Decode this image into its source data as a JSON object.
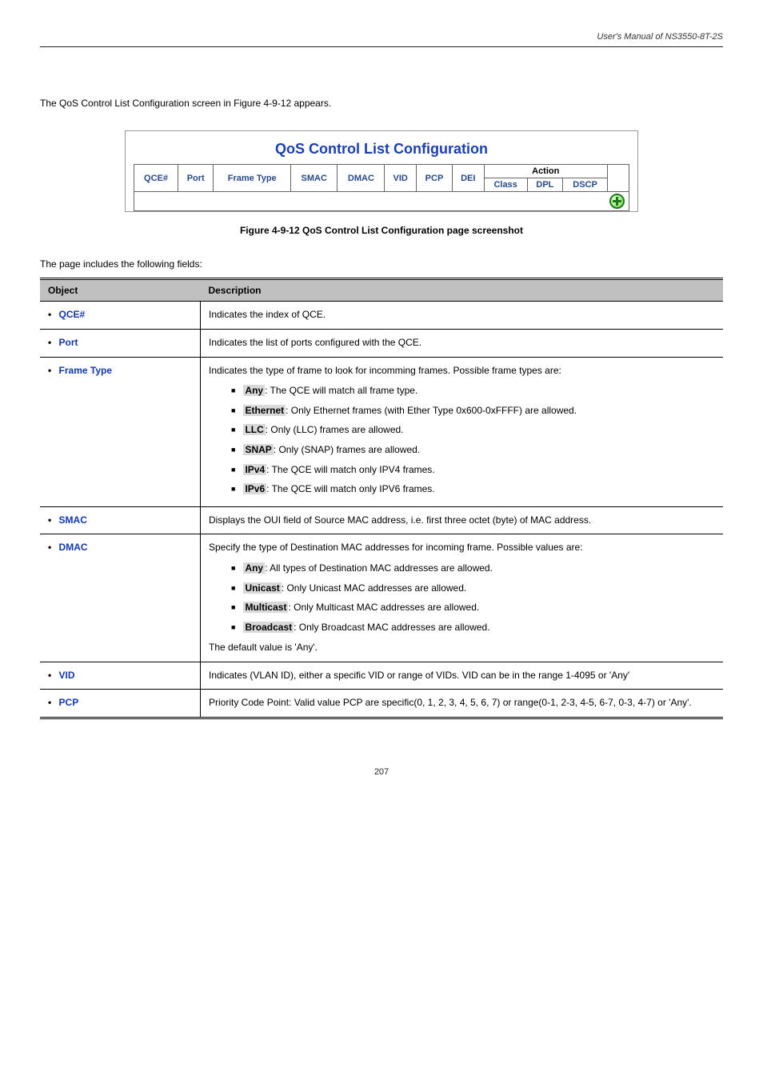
{
  "header": {
    "text": "User's Manual of NS3550-8T-2S"
  },
  "intro": "The QoS Control List Configuration screen in Figure 4-9-12 appears.",
  "screenshot": {
    "title": "QoS Control List Configuration",
    "headers": {
      "qce": "QCE#",
      "port": "Port",
      "frame_type": "Frame Type",
      "smac": "SMAC",
      "dmac": "DMAC",
      "vid": "VID",
      "pcp": "PCP",
      "dei": "DEI",
      "action": "Action",
      "class": "Class",
      "dpl": "DPL",
      "dscp": "DSCP"
    }
  },
  "figcap": "Figure 4-9-12 QoS Control List Configuration page screenshot",
  "desc_intro": "The page includes the following fields:",
  "table": {
    "head_object": "Object",
    "head_desc": "Description",
    "rows": [
      {
        "object": "QCE#",
        "desc_plain": "Indicates the index of QCE."
      },
      {
        "object": "Port",
        "desc_plain": "Indicates the list of ports configured with the QCE."
      },
      {
        "object": "Frame Type",
        "desc_pre": "Indicates the type of frame to look for incomming frames. Possible frame types are:",
        "items": [
          {
            "hl": "Any",
            "tail": ": The QCE will match all frame type."
          },
          {
            "hl": "Ethernet",
            "tail": ": Only Ethernet frames (with Ether Type 0x600-0xFFFF) are allowed."
          },
          {
            "hl": "LLC",
            "tail": ": Only (LLC) frames are allowed."
          },
          {
            "hl": "SNAP",
            "tail": ": Only (SNAP) frames are allowed."
          },
          {
            "hl": "IPv4",
            "tail": ": The QCE will match only IPV4 frames."
          },
          {
            "hl": "IPv6",
            "tail": ": The QCE will match only IPV6 frames."
          }
        ]
      },
      {
        "object": "SMAC",
        "desc_plain": "Displays the OUI field of Source MAC address, i.e. first three octet (byte) of MAC address."
      },
      {
        "object": "DMAC",
        "desc_pre": "Specify the type of Destination MAC addresses for incoming frame. Possible values are:",
        "items": [
          {
            "hl": "Any",
            "tail": ": All types of Destination MAC addresses are allowed."
          },
          {
            "hl": "Unicast",
            "tail": ": Only Unicast MAC addresses are allowed."
          },
          {
            "hl": "Multicast",
            "tail": ": Only Multicast MAC addresses are allowed."
          },
          {
            "hl": "Broadcast",
            "tail": ": Only Broadcast MAC addresses are allowed."
          }
        ],
        "desc_post": "The default value is 'Any'."
      },
      {
        "object": "VID",
        "desc_plain": "Indicates (VLAN ID), either a specific VID or range of VIDs. VID can be in the range 1-4095 or 'Any'"
      },
      {
        "object": "PCP",
        "desc_plain": "Priority Code Point: Valid value PCP are specific(0, 1, 2, 3, 4, 5, 6, 7) or range(0-1, 2-3, 4-5, 6-7, 0-3, 4-7) or 'Any'."
      }
    ]
  },
  "pagenum": "207"
}
